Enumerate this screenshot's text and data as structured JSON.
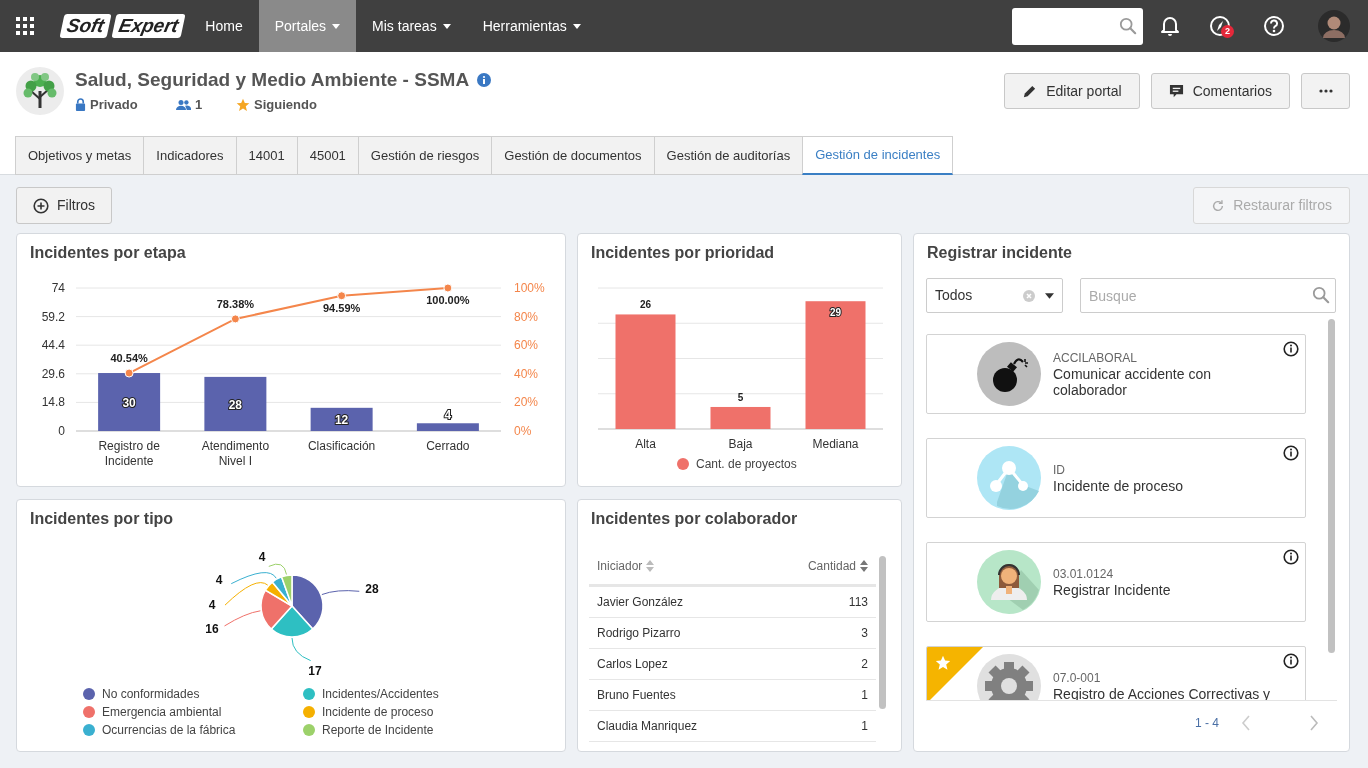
{
  "navbar": {
    "logo": [
      "Soft",
      "Expert"
    ],
    "items": [
      {
        "label": "Home",
        "dropdown": false,
        "selected": false
      },
      {
        "label": "Portales",
        "dropdown": true,
        "selected": true
      },
      {
        "label": "Mis tareas",
        "dropdown": true,
        "selected": false
      },
      {
        "label": "Herramientas",
        "dropdown": true,
        "selected": false
      }
    ],
    "badge": "2"
  },
  "portal": {
    "title": "Salud, Seguridad y Medio Ambiente - SSMA",
    "privacy": "Privado",
    "members": "1",
    "follow": "Siguiendo"
  },
  "actions": [
    {
      "kind": "edit",
      "label": "Editar portal"
    },
    {
      "kind": "comment",
      "label": "Comentarios"
    },
    {
      "kind": "more"
    }
  ],
  "tabs": [
    {
      "label": "Objetivos y metas",
      "selected": false
    },
    {
      "label": "Indicadores",
      "selected": false
    },
    {
      "label": "14001",
      "selected": false
    },
    {
      "label": "45001",
      "selected": false
    },
    {
      "label": "Gestión de riesgos",
      "selected": false
    },
    {
      "label": "Gestión de documentos",
      "selected": false
    },
    {
      "label": "Gestión de auditorías",
      "selected": false
    },
    {
      "label": "Gestión de incidentes",
      "selected": true
    }
  ],
  "filters": {
    "label": "Filtros"
  },
  "restore": {
    "label": "Restaurar filtros",
    "disabled": true
  },
  "stage_card": {
    "title": "Incidentes por etapa",
    "chart_data": {
      "type": "bar",
      "categories": [
        "Registro de Incidente",
        "Atendimento Nivel I",
        "Clasificación",
        "Cerrado"
      ],
      "series": [
        {
          "type": "bar",
          "axis": "y",
          "color": "#5b63ad",
          "values": [
            30,
            28,
            12,
            4
          ]
        },
        {
          "type": "line",
          "axis": "y2",
          "marker": "circle",
          "color": "#f4864b",
          "values": [
            40.54,
            78.38,
            94.59,
            100
          ]
        }
      ],
      "ylim": [
        0,
        74
      ],
      "yticks": [
        0,
        14.8,
        29.6,
        44.4,
        59.2,
        74
      ],
      "y2lim": [
        0,
        100
      ],
      "grid": true,
      "y2ticks": [
        {
          "value": 0,
          "label": "0%"
        },
        {
          "value": 20,
          "label": "20%"
        },
        {
          "value": 40,
          "label": "40%"
        },
        {
          "value": 60,
          "label": "60%"
        },
        {
          "value": 80,
          "label": "80%"
        },
        {
          "value": 100,
          "label": "100%"
        }
      ],
      "value_labels": [
        [
          "30",
          "28",
          "12",
          "4"
        ],
        [
          "40.54%",
          "78.38%",
          "94.59%",
          "100.00%"
        ]
      ]
    }
  },
  "priority_card": {
    "title": "Incidentes por prioridad",
    "chart_data": {
      "type": "bar",
      "categories": [
        "Alta",
        "Baja",
        "Mediana"
      ],
      "series": [
        {
          "name": "Cant. de proyectos",
          "color": "#ef716a",
          "values": [
            26,
            5,
            29
          ]
        }
      ],
      "ylim": [
        0,
        32
      ],
      "grid": true,
      "legend": true,
      "data_labels": true
    }
  },
  "type_card": {
    "title": "Incidentes por tipo",
    "chart_data": {
      "type": "pie",
      "categories": [
        "No conformidades",
        "Incidentes/Accidentes",
        "Emergencia ambiental",
        "Incidente de proceso",
        "Ocurrencias de la fábrica",
        "Reporte de Incidente"
      ],
      "values": [
        28,
        17,
        16,
        4,
        4,
        4
      ],
      "colors": [
        "#5b63ad",
        "#2ebfc2",
        "#ef716a",
        "#f5b000",
        "#3ab0d0",
        "#9cd16a"
      ],
      "legend": true,
      "data_labels": true
    }
  },
  "collab_card": {
    "title": "Incidentes por colaborador",
    "columns": [
      "Iniciador",
      "Cantidad"
    ],
    "rows": [
      [
        "Javier González",
        "113"
      ],
      [
        "Rodrigo Pizarro",
        "3"
      ],
      [
        "Carlos Lopez",
        "2"
      ],
      [
        "Bruno Fuentes",
        "1"
      ],
      [
        "Claudia Manriquez",
        "1"
      ]
    ]
  },
  "register_card": {
    "title": "Registrar incidente",
    "filter": {
      "value": "Todos"
    },
    "search": {
      "placeholder": "Busque"
    },
    "items": [
      {
        "kind": "bomb",
        "code": "ACCILABORAL",
        "title": "Comunicar accidente con colaborador",
        "favorite": false
      },
      {
        "kind": "network",
        "code": "ID",
        "title": "Incidente de proceso",
        "favorite": false
      },
      {
        "kind": "person",
        "code": "03.01.0124",
        "title": "Registrar Incidente",
        "favorite": false
      },
      {
        "kind": "gear",
        "code": "07.0-001",
        "title": "Registro de Acciones Correctivas y",
        "favorite": true
      }
    ],
    "pagination": "1 - 4"
  }
}
